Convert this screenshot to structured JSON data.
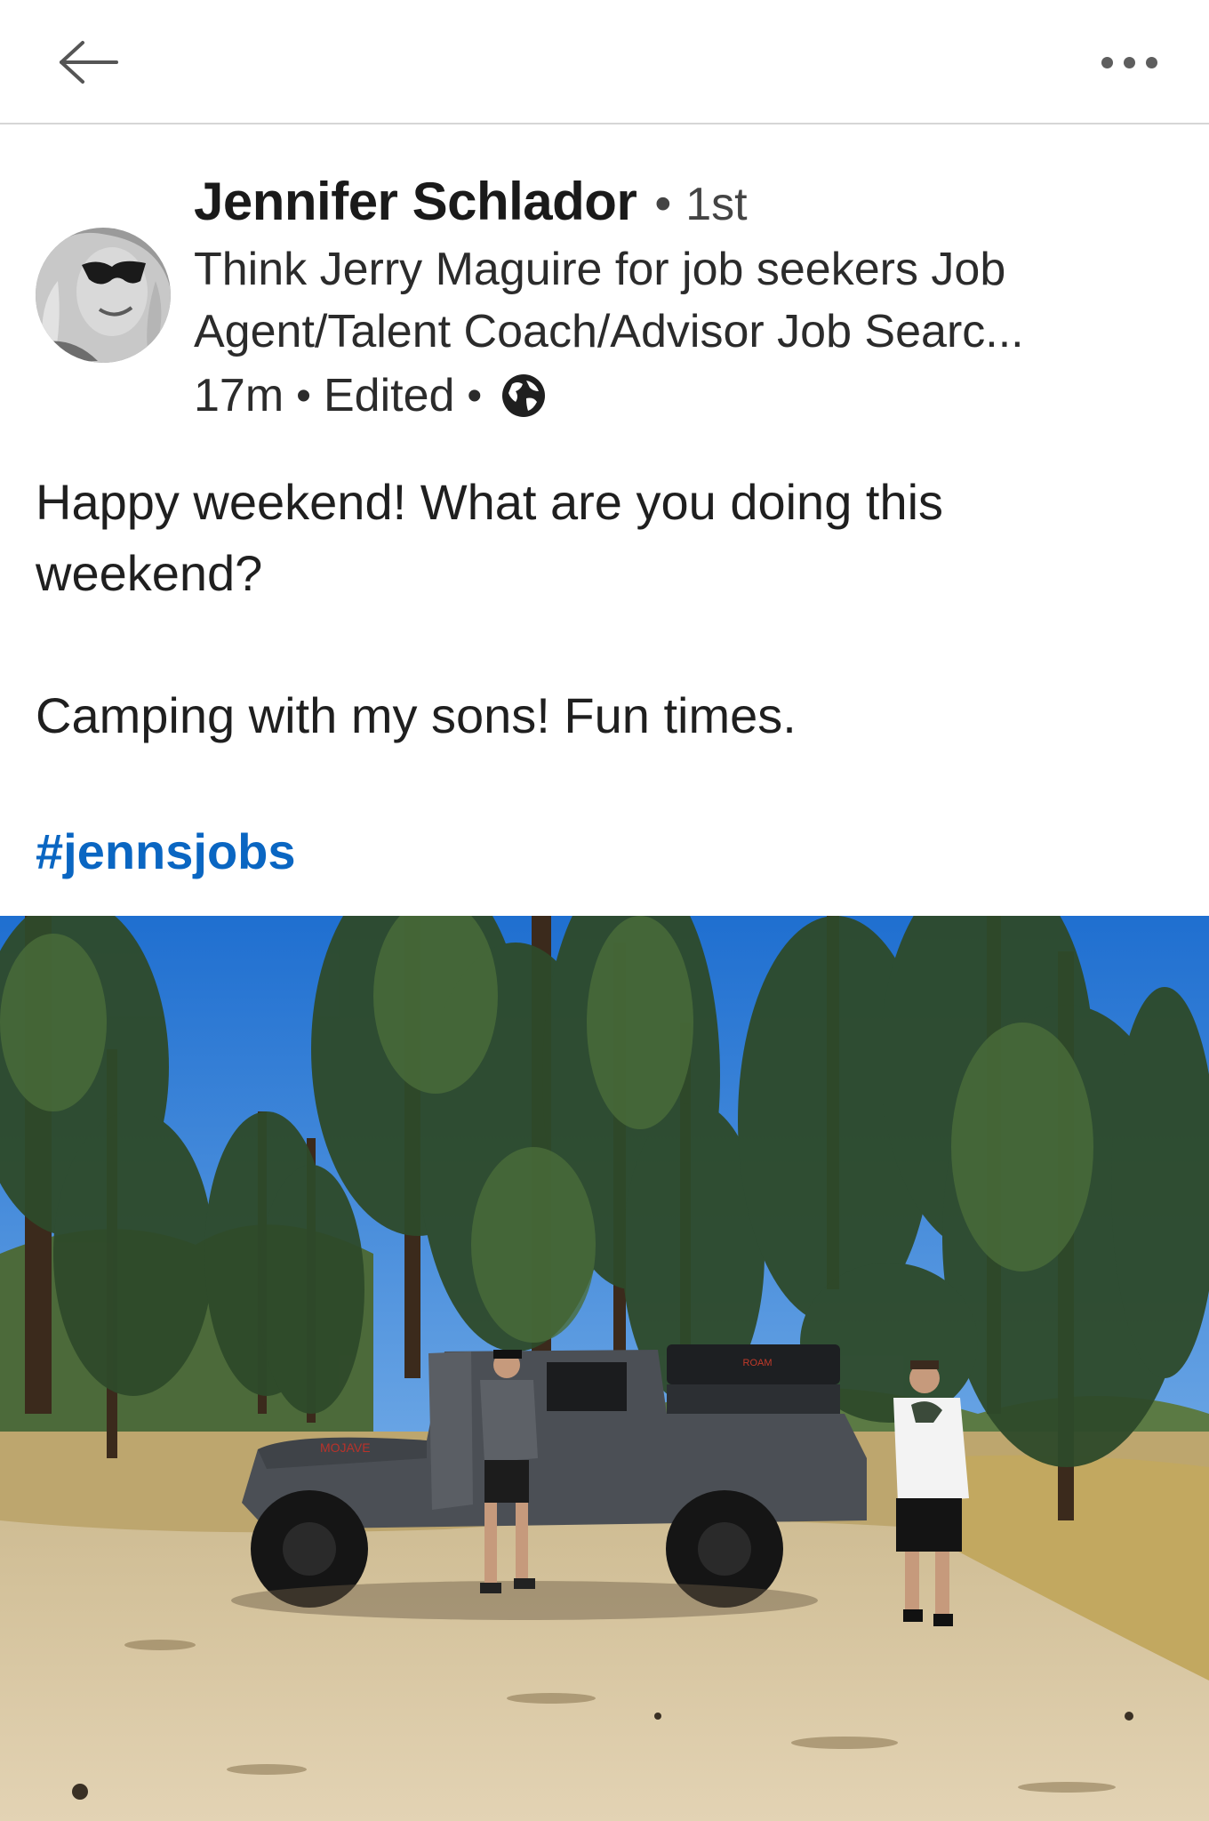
{
  "nav": {
    "back_icon": "arrow-left-icon",
    "more_icon": "more-horizontal-icon"
  },
  "post": {
    "author": {
      "name": "Jennifer Schlador",
      "separator": "•",
      "degree": "1st",
      "headline": "Think Jerry Maguire for job seekers Job Agent/Talent Coach/Advisor Job Searc...",
      "avatar_icon": "profile-photo"
    },
    "meta": {
      "time": "17m",
      "sep1": "•",
      "edited": "Edited",
      "sep2": "•",
      "visibility_icon": "globe-icon"
    },
    "text": {
      "line1": "Happy weekend! What are you doing this weekend?",
      "line2": "Camping with my sons! Fun times."
    },
    "hashtag": "#jennsjobs",
    "image": {
      "logo_on_tent": "ROAM",
      "logo_on_hood": "MOJAVE"
    }
  },
  "colors": {
    "link": "#0a66c2",
    "divider": "#d6d6d6",
    "sky": "#2f7fd6",
    "ground": "#d9c7a0"
  }
}
